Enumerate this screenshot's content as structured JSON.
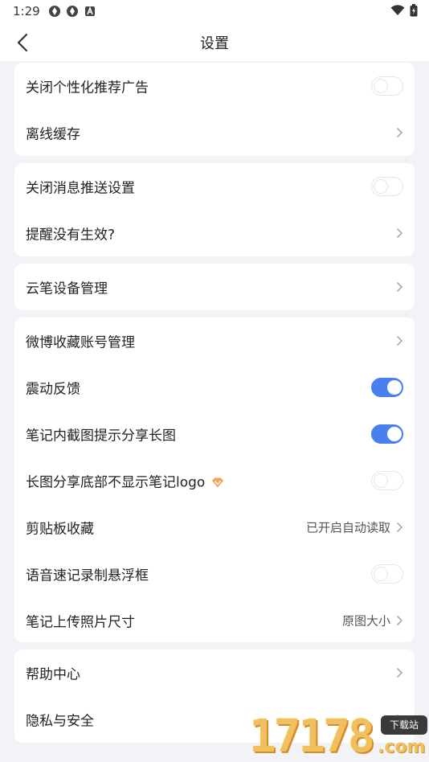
{
  "status_bar": {
    "time": "1:29",
    "left_icons": [
      "app-notification-icon",
      "app-notification-icon",
      "a-badge-icon"
    ],
    "right_icons": [
      "wifi-icon",
      "battery-icon"
    ]
  },
  "nav": {
    "title": "设置",
    "back_icon": "chevron-left-icon"
  },
  "cards": [
    {
      "rows": [
        {
          "label": "关闭个性化推荐广告",
          "control": "toggle",
          "on": false
        },
        {
          "label": "离线缓存",
          "control": "chevron"
        }
      ]
    },
    {
      "rows": [
        {
          "label": "关闭消息推送设置",
          "control": "toggle",
          "on": false
        },
        {
          "label": "提醒没有生效?",
          "control": "chevron"
        }
      ]
    },
    {
      "rows": [
        {
          "label": "云笔设备管理",
          "control": "chevron"
        }
      ]
    },
    {
      "rows": [
        {
          "label": "微博收藏账号管理",
          "control": "chevron"
        },
        {
          "label": "震动反馈",
          "control": "toggle",
          "on": true
        },
        {
          "label": "笔记内截图提示分享长图",
          "control": "toggle",
          "on": true
        },
        {
          "label": "长图分享底部不显示笔记logo",
          "control": "toggle",
          "on": false,
          "badge_icon": "vip-diamond-icon"
        },
        {
          "label": "剪贴板收藏",
          "control": "chevron",
          "value": "已开启自动读取"
        },
        {
          "label": "语音速记录制悬浮框",
          "control": "toggle",
          "on": false
        },
        {
          "label": "笔记上传照片尺寸",
          "control": "chevron",
          "value": "原图大小"
        }
      ]
    },
    {
      "rows": [
        {
          "label": "帮助中心",
          "control": "chevron"
        },
        {
          "label": "隐私与安全",
          "control": "chevron"
        }
      ]
    }
  ],
  "watermark": {
    "digits": "17178",
    "badge": "下载站",
    "suffix": ".com"
  },
  "colors": {
    "accent": "#4a7ff0",
    "background": "#f2f3f7",
    "card": "#ffffff"
  }
}
